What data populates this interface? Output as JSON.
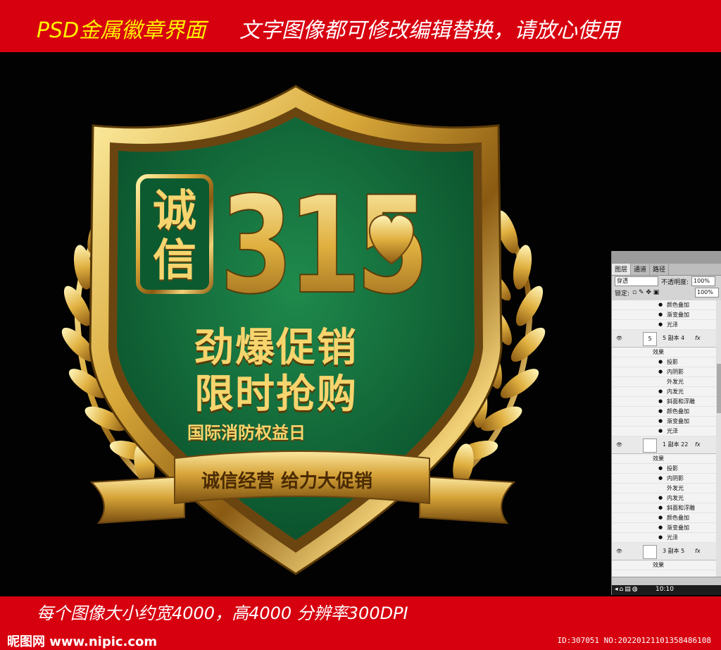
{
  "header": {
    "title": "PSD金属徽章界面",
    "subtitle": "文字图像都可修改编辑替换，请放心使用"
  },
  "badge": {
    "seal_text_1": "诚",
    "seal_text_2": "信",
    "number": "315",
    "line1": "劲爆促销",
    "line2": "限时抢购",
    "line3": "国际消防权益日",
    "ribbon": "诚信经营 给力大促销"
  },
  "panel": {
    "tabs": [
      "图层",
      "通道",
      "路径"
    ],
    "blend_mode": "穿透",
    "opacity_label": "不透明度:",
    "opacity_value": "100%",
    "lock_label": "锁定:",
    "fill_value": "100%",
    "rows": [
      {
        "type": "effect",
        "label": "颜色叠加"
      },
      {
        "type": "effect",
        "label": "渐变叠加"
      },
      {
        "type": "effect",
        "label": "光泽"
      },
      {
        "type": "layer",
        "label": "5 副本 4",
        "thumb": "5"
      },
      {
        "type": "fx",
        "label": "效果"
      },
      {
        "type": "effect",
        "label": "投影"
      },
      {
        "type": "effect",
        "label": "内阴影"
      },
      {
        "type": "effect-off",
        "label": "外发光"
      },
      {
        "type": "effect",
        "label": "内发光"
      },
      {
        "type": "effect",
        "label": "斜面和浮雕"
      },
      {
        "type": "effect",
        "label": "颜色叠加"
      },
      {
        "type": "effect",
        "label": "渐变叠加"
      },
      {
        "type": "effect",
        "label": "光泽"
      },
      {
        "type": "layer",
        "label": "1 副本 22",
        "thumb": ""
      },
      {
        "type": "fx",
        "label": "效果"
      },
      {
        "type": "effect",
        "label": "投影"
      },
      {
        "type": "effect",
        "label": "内阴影"
      },
      {
        "type": "effect-off",
        "label": "外发光"
      },
      {
        "type": "effect",
        "label": "内发光"
      },
      {
        "type": "effect",
        "label": "斜面和浮雕"
      },
      {
        "type": "effect",
        "label": "颜色叠加"
      },
      {
        "type": "effect",
        "label": "渐变叠加"
      },
      {
        "type": "effect",
        "label": "光泽"
      },
      {
        "type": "layer",
        "label": "3 副本 5",
        "thumb": ""
      },
      {
        "type": "fx",
        "label": "效果"
      }
    ],
    "taskbar_time": "10:10"
  },
  "footer": {
    "info": "每个图像大小约宽4000，高4000    分辨率300DPI",
    "logo": "昵图网 www.nipic.com",
    "id": "ID:307051 NO:20220121101358486108"
  },
  "colors": {
    "banner_red": "#d7000f",
    "title_yellow": "#fff200",
    "shield_green": "#0e6b3a",
    "gold": "#d9a93a"
  }
}
